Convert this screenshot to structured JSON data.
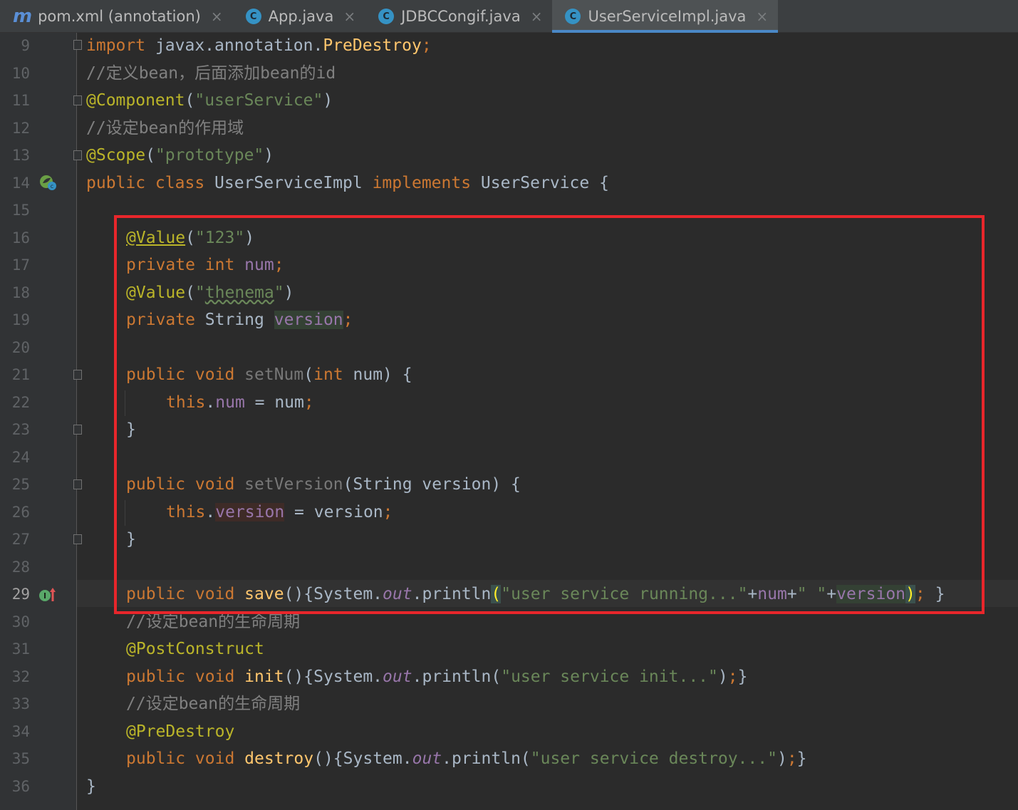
{
  "tabs": [
    {
      "label": "pom.xml (annotation)",
      "icon": "maven-icon"
    },
    {
      "label": "App.java",
      "icon": "java-class-icon"
    },
    {
      "label": "JDBCCongif.java",
      "icon": "java-class-icon"
    },
    {
      "label": "UserServiceImpl.java",
      "icon": "java-class-icon",
      "active": true
    }
  ],
  "line_numbers": [
    "9",
    "10",
    "11",
    "12",
    "13",
    "14",
    "15",
    "16",
    "17",
    "18",
    "19",
    "20",
    "21",
    "22",
    "23",
    "24",
    "25",
    "26",
    "27",
    "28",
    "29",
    "30",
    "31",
    "32",
    "33",
    "34",
    "35",
    "36"
  ],
  "code": {
    "l9": [
      "import",
      " javax.annotation.",
      "PreDestroy",
      ";"
    ],
    "l10": "//定义bean，后面添加bean的id",
    "l11": [
      "@Component",
      "(",
      "\"userService\"",
      ")"
    ],
    "l12": "//设定bean的作用域",
    "l13": [
      "@Scope",
      "(",
      "\"prototype\"",
      ")"
    ],
    "l14": [
      "public class ",
      "UserServiceImpl ",
      "implements ",
      "UserService {"
    ],
    "l16": [
      "@Value",
      "(",
      "\"123\"",
      ")"
    ],
    "l17": [
      "private int ",
      "num",
      ";"
    ],
    "l18": [
      "@Value",
      "(",
      "\"",
      "thenema",
      "\"",
      ")"
    ],
    "l19": [
      "private ",
      "String ",
      "version",
      ";"
    ],
    "l21": [
      "public void ",
      "setNum",
      "(",
      "int ",
      "num) {"
    ],
    "l22": [
      "this",
      ".",
      "num",
      " = num",
      ";"
    ],
    "l23": "}",
    "l25": [
      "public void ",
      "setVersion",
      "(String version) {"
    ],
    "l26": [
      "this",
      ".",
      "version",
      " = version",
      ";"
    ],
    "l27": "}",
    "l29": [
      "public void ",
      "save",
      "(){System.",
      "out",
      ".println",
      "(",
      "\"user service running...\"",
      "+",
      "num",
      "+",
      "\" \"",
      "+",
      "version",
      ")",
      ";",
      " }"
    ],
    "l30": "//设定bean的生命周期",
    "l31": "@PostConstruct",
    "l32": [
      "public void ",
      "init",
      "(){System.",
      "out",
      ".println(",
      "\"user service init...\"",
      ")",
      ";",
      "}"
    ],
    "l33": "//设定bean的生命周期",
    "l34": "@PreDestroy",
    "l35": [
      "public void ",
      "destroy",
      "(){System.",
      "out",
      ".println(",
      "\"user service destroy...\"",
      ")",
      ";",
      "}"
    ],
    "l36": "}"
  },
  "colors": {
    "keyword": "#cc7832",
    "annotation": "#bbb529",
    "string": "#6a8759",
    "comment": "#808080",
    "field": "#9876aa",
    "method": "#ffc66d",
    "text": "#a9b7c6",
    "highlight_box": "#e8262b"
  }
}
